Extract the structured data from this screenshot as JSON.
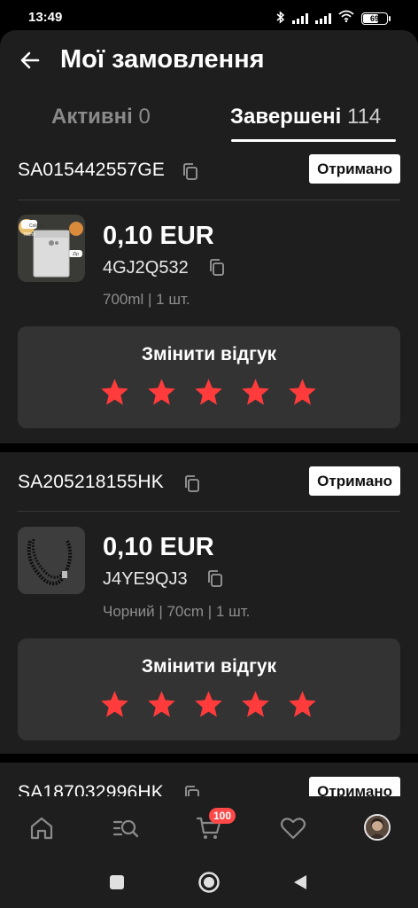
{
  "status_bar": {
    "time": "13:49",
    "battery_level": "69"
  },
  "header": {
    "title": "Мої замовлення",
    "back_icon": "arrow-left-icon"
  },
  "tabs": [
    {
      "label": "Активні",
      "count": "0",
      "active": false
    },
    {
      "label": "Завершені",
      "count": "114",
      "active": true
    }
  ],
  "orders": [
    {
      "order_id": "SA015442557GE",
      "status": "Отримано",
      "price": "0,10 EUR",
      "sku": "4GJ2Q532",
      "variant": "700ml | 1 шт.",
      "thumb_labels": [
        "Colour",
        "700ml",
        "Zip"
      ],
      "review_label": "Змінити відгук",
      "rating": 5
    },
    {
      "order_id": "SA205218155HK",
      "status": "Отримано",
      "price": "0,10 EUR",
      "sku": "J4YE9QJ3",
      "variant": "Чорний | 70cm | 1 шт.",
      "review_label": "Змінити відгук",
      "rating": 5
    },
    {
      "order_id": "SA187032996HK",
      "status": "Отримано"
    }
  ],
  "bottom_nav": [
    {
      "name": "home",
      "icon": "home-icon"
    },
    {
      "name": "search",
      "icon": "search-list-icon"
    },
    {
      "name": "cart",
      "icon": "cart-icon",
      "badge": "100"
    },
    {
      "name": "wishlist",
      "icon": "heart-icon"
    },
    {
      "name": "profile",
      "icon": "avatar"
    }
  ],
  "colors": {
    "background": "#1e1e1e",
    "card_box": "#333334",
    "star": "#ff3b3b",
    "badge": "#ff4848",
    "muted_text": "#8d8d8d"
  }
}
